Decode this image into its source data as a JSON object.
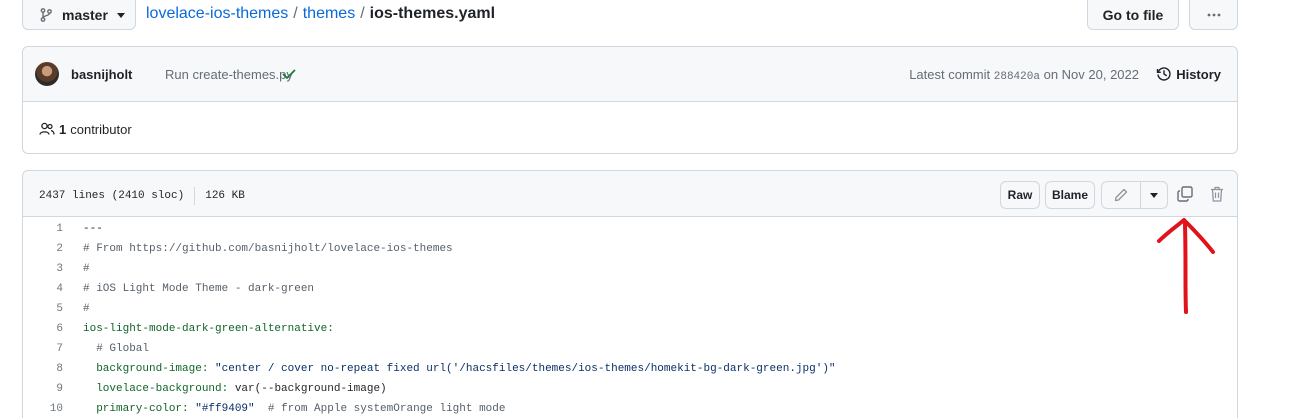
{
  "header": {
    "branch": "master",
    "breadcrumb": [
      {
        "label": "lovelace-ios-themes",
        "link": true
      },
      {
        "label": "themes",
        "link": true
      },
      {
        "label": "ios-themes.yaml",
        "link": false
      }
    ],
    "separator": "/",
    "goto_file": "Go to file"
  },
  "commit": {
    "author": "basnijholt",
    "message": "Run create-themes.py",
    "latest_prefix": "Latest commit",
    "sha": "288420a",
    "date_text": "on Nov 20, 2022",
    "history": "History",
    "contributors_count": "1",
    "contributors_label": "contributor"
  },
  "file": {
    "lines_info": "2437 lines (2410 sloc)",
    "size": "126 KB",
    "raw": "Raw",
    "blame": "Blame",
    "code_lines": [
      {
        "n": "1",
        "text": "---",
        "kind": "plain"
      },
      {
        "n": "2",
        "text": "# From https://github.com/basnijholt/lovelace-ios-themes",
        "kind": "comment"
      },
      {
        "n": "3",
        "text": "#",
        "kind": "comment"
      },
      {
        "n": "4",
        "text": "# iOS Light Mode Theme - dark-green",
        "kind": "comment"
      },
      {
        "n": "5",
        "text": "#",
        "kind": "comment"
      },
      {
        "n": "6",
        "text": "ios-light-mode-dark-green-alternative:",
        "kind": "key"
      },
      {
        "n": "7",
        "text": "  # Global",
        "kind": "comment"
      },
      {
        "n": "8",
        "key": "  background-image:",
        "value": " \"center / cover no-repeat fixed url('/hacsfiles/themes/ios-themes/homekit-bg-dark-green.jpg')\"",
        "kind": "pair"
      },
      {
        "n": "9",
        "key": "  lovelace-background:",
        "value": " var(--background-image)",
        "kind": "pair"
      },
      {
        "n": "10",
        "key": "  primary-color:",
        "value": " \"#ff9409\"",
        "comment": "  # from Apple systemOrange light mode",
        "kind": "pair"
      }
    ]
  },
  "colors": {
    "link": "#0969da",
    "check": "#1a7f37",
    "annotation": "#e0131b",
    "border": "#d0d7de"
  },
  "icons": [
    "git-branch-icon",
    "kebab-horizontal-icon",
    "check-icon",
    "history-icon",
    "people-icon",
    "pencil-icon",
    "copy-icon",
    "trash-icon",
    "red-arrow-annotation"
  ]
}
